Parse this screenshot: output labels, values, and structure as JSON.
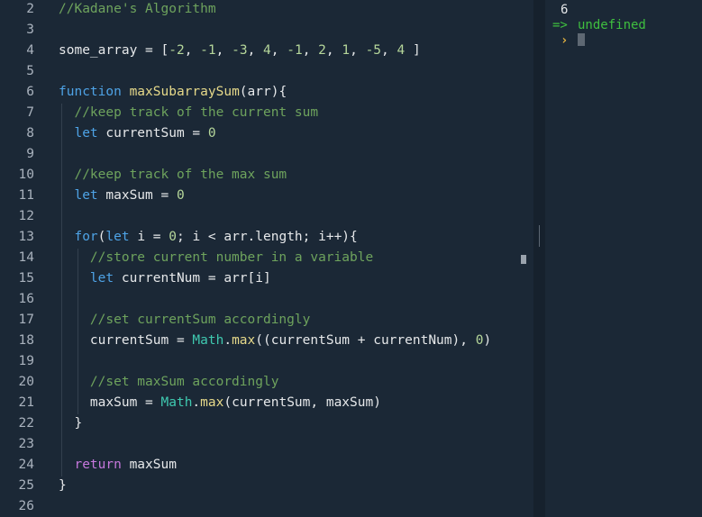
{
  "editor": {
    "lines": [
      {
        "n": "2",
        "tokens": [
          {
            "t": "//Kadane's Algorithm",
            "c": "#6ea35d"
          }
        ]
      },
      {
        "n": "3",
        "tokens": []
      },
      {
        "n": "4",
        "tokens": [
          {
            "t": "some_array = [",
            "c": "#e6e8ea"
          },
          {
            "t": "-2",
            "c": "#b5d69a"
          },
          {
            "t": ", ",
            "c": "#e6e8ea"
          },
          {
            "t": "-1",
            "c": "#b5d69a"
          },
          {
            "t": ", ",
            "c": "#e6e8ea"
          },
          {
            "t": "-3",
            "c": "#b5d69a"
          },
          {
            "t": ", ",
            "c": "#e6e8ea"
          },
          {
            "t": "4",
            "c": "#b5d69a"
          },
          {
            "t": ", ",
            "c": "#e6e8ea"
          },
          {
            "t": "-1",
            "c": "#b5d69a"
          },
          {
            "t": ", ",
            "c": "#e6e8ea"
          },
          {
            "t": "2",
            "c": "#b5d69a"
          },
          {
            "t": ", ",
            "c": "#e6e8ea"
          },
          {
            "t": "1",
            "c": "#b5d69a"
          },
          {
            "t": ", ",
            "c": "#e6e8ea"
          },
          {
            "t": "-5",
            "c": "#b5d69a"
          },
          {
            "t": ", ",
            "c": "#e6e8ea"
          },
          {
            "t": "4",
            "c": "#b5d69a"
          },
          {
            "t": " ]",
            "c": "#e6e8ea"
          }
        ]
      },
      {
        "n": "5",
        "tokens": []
      },
      {
        "n": "6",
        "tokens": [
          {
            "t": "function ",
            "c": "#4ea3e6"
          },
          {
            "t": "maxSubarraySum",
            "c": "#e6d98a"
          },
          {
            "t": "(arr){",
            "c": "#e6e8ea"
          }
        ]
      },
      {
        "n": "7",
        "tokens": [
          {
            "t": "  //keep track of the current sum",
            "c": "#6ea35d"
          }
        ]
      },
      {
        "n": "8",
        "tokens": [
          {
            "t": "  ",
            "c": "#e6e8ea"
          },
          {
            "t": "let ",
            "c": "#4ea3e6"
          },
          {
            "t": "currentSum = ",
            "c": "#e6e8ea"
          },
          {
            "t": "0",
            "c": "#b5d69a"
          }
        ]
      },
      {
        "n": "9",
        "tokens": []
      },
      {
        "n": "10",
        "tokens": [
          {
            "t": "  //keep track of the max sum",
            "c": "#6ea35d"
          }
        ]
      },
      {
        "n": "11",
        "tokens": [
          {
            "t": "  ",
            "c": "#e6e8ea"
          },
          {
            "t": "let ",
            "c": "#4ea3e6"
          },
          {
            "t": "maxSum = ",
            "c": "#e6e8ea"
          },
          {
            "t": "0",
            "c": "#b5d69a"
          }
        ]
      },
      {
        "n": "12",
        "tokens": []
      },
      {
        "n": "13",
        "tokens": [
          {
            "t": "  ",
            "c": "#e6e8ea"
          },
          {
            "t": "for",
            "c": "#4ea3e6"
          },
          {
            "t": "(",
            "c": "#e6e8ea"
          },
          {
            "t": "let ",
            "c": "#4ea3e6"
          },
          {
            "t": "i = ",
            "c": "#e6e8ea"
          },
          {
            "t": "0",
            "c": "#b5d69a"
          },
          {
            "t": "; i < arr.length; i++){",
            "c": "#e6e8ea"
          }
        ]
      },
      {
        "n": "14",
        "tokens": [
          {
            "t": "    //store current number in a variable",
            "c": "#6ea35d"
          }
        ]
      },
      {
        "n": "15",
        "tokens": [
          {
            "t": "    ",
            "c": "#e6e8ea"
          },
          {
            "t": "let ",
            "c": "#4ea3e6"
          },
          {
            "t": "currentNum = arr[i]",
            "c": "#e6e8ea"
          }
        ]
      },
      {
        "n": "16",
        "tokens": []
      },
      {
        "n": "17",
        "tokens": [
          {
            "t": "    //set currentSum accordingly",
            "c": "#6ea35d"
          }
        ]
      },
      {
        "n": "18",
        "tokens": [
          {
            "t": "    currentSum = ",
            "c": "#e6e8ea"
          },
          {
            "t": "Math",
            "c": "#3fc9b0"
          },
          {
            "t": ".",
            "c": "#e6e8ea"
          },
          {
            "t": "max",
            "c": "#e6d98a"
          },
          {
            "t": "((currentSum + currentNum), ",
            "c": "#e6e8ea"
          },
          {
            "t": "0",
            "c": "#b5d69a"
          },
          {
            "t": ")",
            "c": "#e6e8ea"
          }
        ]
      },
      {
        "n": "19",
        "tokens": []
      },
      {
        "n": "20",
        "tokens": [
          {
            "t": "    //set maxSum accordingly",
            "c": "#6ea35d"
          }
        ]
      },
      {
        "n": "21",
        "tokens": [
          {
            "t": "    maxSum = ",
            "c": "#e6e8ea"
          },
          {
            "t": "Math",
            "c": "#3fc9b0"
          },
          {
            "t": ".",
            "c": "#e6e8ea"
          },
          {
            "t": "max",
            "c": "#e6d98a"
          },
          {
            "t": "(currentSum, maxSum)",
            "c": "#e6e8ea"
          }
        ]
      },
      {
        "n": "22",
        "tokens": [
          {
            "t": "  }",
            "c": "#e6e8ea"
          }
        ]
      },
      {
        "n": "23",
        "tokens": []
      },
      {
        "n": "24",
        "tokens": [
          {
            "t": "  ",
            "c": "#e6e8ea"
          },
          {
            "t": "return ",
            "c": "#c678dd"
          },
          {
            "t": "maxSum",
            "c": "#e6e8ea"
          }
        ]
      },
      {
        "n": "25",
        "tokens": [
          {
            "t": "}",
            "c": "#e6e8ea"
          }
        ]
      },
      {
        "n": "26",
        "tokens": []
      }
    ]
  },
  "console": {
    "result_value": "6",
    "return_arrow": "=>",
    "return_text": "undefined",
    "prompt_glyph": "›",
    "colors": {
      "result": "#e6e8ea",
      "return": "#3fbf3f",
      "prompt": "#e0b040"
    }
  }
}
